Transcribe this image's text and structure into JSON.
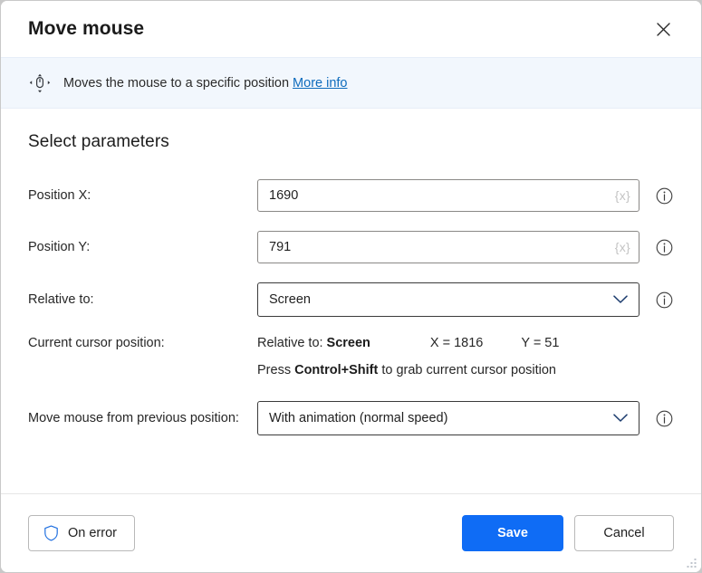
{
  "window": {
    "title": "Move mouse",
    "close_label": "×"
  },
  "infobar": {
    "icon": "move-mouse-icon",
    "text": "Moves the mouse to a specific position",
    "link_label": "More info"
  },
  "main": {
    "section_title": "Select parameters",
    "fields": [
      {
        "label": "Position X:",
        "value": "1690",
        "variable_glyph": "{x}",
        "type": "text"
      },
      {
        "label": "Position Y:",
        "value": "791",
        "variable_glyph": "{x}",
        "type": "text"
      },
      {
        "label": "Relative to:",
        "value": "Screen",
        "type": "select"
      }
    ],
    "cursor_position": {
      "label": "Current cursor position:",
      "relative_label": "Relative to:",
      "relative_value": "Screen",
      "x_text": "X = 1816",
      "y_text": "Y = 51",
      "hint_prefix": "Press ",
      "hint_keys": "Control+Shift",
      "hint_suffix": " to grab current cursor position"
    },
    "move_mode": {
      "label": "Move mouse from previous position:",
      "value": "With animation (normal speed)"
    }
  },
  "footer": {
    "on_error_label": "On error",
    "save_label": "Save",
    "cancel_label": "Cancel"
  },
  "colors": {
    "accent": "#0f6cf5",
    "link": "#0f6cbd",
    "infobar_bg": "#f2f7fd",
    "shield": "#1f6fe0"
  }
}
